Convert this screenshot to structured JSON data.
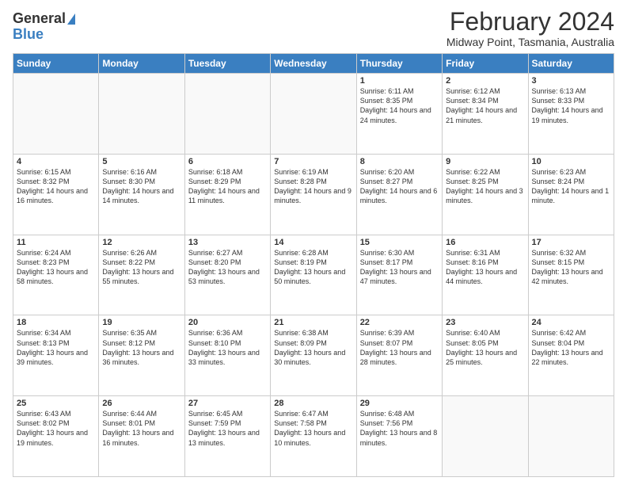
{
  "header": {
    "logo_line1": "General",
    "logo_line2": "Blue",
    "month": "February 2024",
    "location": "Midway Point, Tasmania, Australia"
  },
  "days_of_week": [
    "Sunday",
    "Monday",
    "Tuesday",
    "Wednesday",
    "Thursday",
    "Friday",
    "Saturday"
  ],
  "weeks": [
    [
      {
        "day": "",
        "info": ""
      },
      {
        "day": "",
        "info": ""
      },
      {
        "day": "",
        "info": ""
      },
      {
        "day": "",
        "info": ""
      },
      {
        "day": "1",
        "info": "Sunrise: 6:11 AM\nSunset: 8:35 PM\nDaylight: 14 hours and 24 minutes."
      },
      {
        "day": "2",
        "info": "Sunrise: 6:12 AM\nSunset: 8:34 PM\nDaylight: 14 hours and 21 minutes."
      },
      {
        "day": "3",
        "info": "Sunrise: 6:13 AM\nSunset: 8:33 PM\nDaylight: 14 hours and 19 minutes."
      }
    ],
    [
      {
        "day": "4",
        "info": "Sunrise: 6:15 AM\nSunset: 8:32 PM\nDaylight: 14 hours and 16 minutes."
      },
      {
        "day": "5",
        "info": "Sunrise: 6:16 AM\nSunset: 8:30 PM\nDaylight: 14 hours and 14 minutes."
      },
      {
        "day": "6",
        "info": "Sunrise: 6:18 AM\nSunset: 8:29 PM\nDaylight: 14 hours and 11 minutes."
      },
      {
        "day": "7",
        "info": "Sunrise: 6:19 AM\nSunset: 8:28 PM\nDaylight: 14 hours and 9 minutes."
      },
      {
        "day": "8",
        "info": "Sunrise: 6:20 AM\nSunset: 8:27 PM\nDaylight: 14 hours and 6 minutes."
      },
      {
        "day": "9",
        "info": "Sunrise: 6:22 AM\nSunset: 8:25 PM\nDaylight: 14 hours and 3 minutes."
      },
      {
        "day": "10",
        "info": "Sunrise: 6:23 AM\nSunset: 8:24 PM\nDaylight: 14 hours and 1 minute."
      }
    ],
    [
      {
        "day": "11",
        "info": "Sunrise: 6:24 AM\nSunset: 8:23 PM\nDaylight: 13 hours and 58 minutes."
      },
      {
        "day": "12",
        "info": "Sunrise: 6:26 AM\nSunset: 8:22 PM\nDaylight: 13 hours and 55 minutes."
      },
      {
        "day": "13",
        "info": "Sunrise: 6:27 AM\nSunset: 8:20 PM\nDaylight: 13 hours and 53 minutes."
      },
      {
        "day": "14",
        "info": "Sunrise: 6:28 AM\nSunset: 8:19 PM\nDaylight: 13 hours and 50 minutes."
      },
      {
        "day": "15",
        "info": "Sunrise: 6:30 AM\nSunset: 8:17 PM\nDaylight: 13 hours and 47 minutes."
      },
      {
        "day": "16",
        "info": "Sunrise: 6:31 AM\nSunset: 8:16 PM\nDaylight: 13 hours and 44 minutes."
      },
      {
        "day": "17",
        "info": "Sunrise: 6:32 AM\nSunset: 8:15 PM\nDaylight: 13 hours and 42 minutes."
      }
    ],
    [
      {
        "day": "18",
        "info": "Sunrise: 6:34 AM\nSunset: 8:13 PM\nDaylight: 13 hours and 39 minutes."
      },
      {
        "day": "19",
        "info": "Sunrise: 6:35 AM\nSunset: 8:12 PM\nDaylight: 13 hours and 36 minutes."
      },
      {
        "day": "20",
        "info": "Sunrise: 6:36 AM\nSunset: 8:10 PM\nDaylight: 13 hours and 33 minutes."
      },
      {
        "day": "21",
        "info": "Sunrise: 6:38 AM\nSunset: 8:09 PM\nDaylight: 13 hours and 30 minutes."
      },
      {
        "day": "22",
        "info": "Sunrise: 6:39 AM\nSunset: 8:07 PM\nDaylight: 13 hours and 28 minutes."
      },
      {
        "day": "23",
        "info": "Sunrise: 6:40 AM\nSunset: 8:05 PM\nDaylight: 13 hours and 25 minutes."
      },
      {
        "day": "24",
        "info": "Sunrise: 6:42 AM\nSunset: 8:04 PM\nDaylight: 13 hours and 22 minutes."
      }
    ],
    [
      {
        "day": "25",
        "info": "Sunrise: 6:43 AM\nSunset: 8:02 PM\nDaylight: 13 hours and 19 minutes."
      },
      {
        "day": "26",
        "info": "Sunrise: 6:44 AM\nSunset: 8:01 PM\nDaylight: 13 hours and 16 minutes."
      },
      {
        "day": "27",
        "info": "Sunrise: 6:45 AM\nSunset: 7:59 PM\nDaylight: 13 hours and 13 minutes."
      },
      {
        "day": "28",
        "info": "Sunrise: 6:47 AM\nSunset: 7:58 PM\nDaylight: 13 hours and 10 minutes."
      },
      {
        "day": "29",
        "info": "Sunrise: 6:48 AM\nSunset: 7:56 PM\nDaylight: 13 hours and 8 minutes."
      },
      {
        "day": "",
        "info": ""
      },
      {
        "day": "",
        "info": ""
      }
    ]
  ]
}
